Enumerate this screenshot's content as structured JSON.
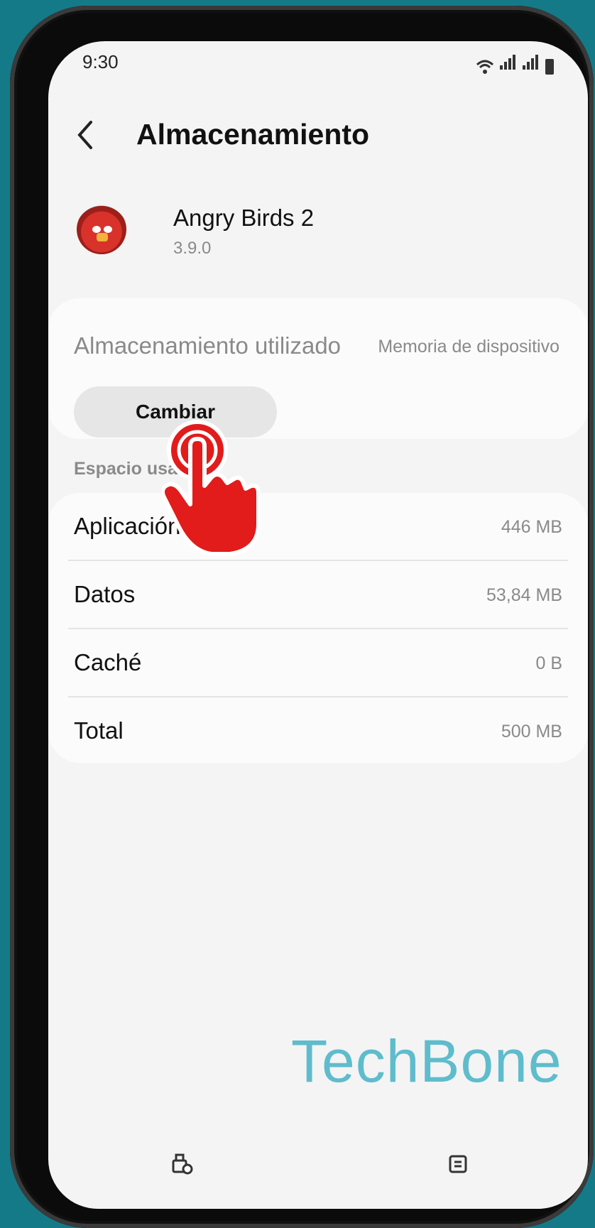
{
  "status_bar": {
    "time": "9:30"
  },
  "header": {
    "title": "Almacenamiento"
  },
  "app": {
    "name": "Angry Birds 2",
    "version": "3.9.0"
  },
  "storage_used_card": {
    "label": "Almacenamiento utilizado",
    "value": "Memoria de dispositivo",
    "change_button": "Cambiar"
  },
  "section": {
    "label": "Espacio usado"
  },
  "usage_rows": [
    {
      "label": "Aplicación",
      "value": "446 MB"
    },
    {
      "label": "Datos",
      "value": "53,84 MB"
    },
    {
      "label": "Caché",
      "value": "0 B"
    },
    {
      "label": "Total",
      "value": "500 MB"
    }
  ],
  "bottom_nav": [
    {
      "icon": "clear-data-icon"
    },
    {
      "icon": "clear-cache-icon"
    }
  ],
  "watermark": "TechBone",
  "colors": {
    "background": "#157a88",
    "screen": "#f4f4f4",
    "accent": "#e21b1b"
  }
}
